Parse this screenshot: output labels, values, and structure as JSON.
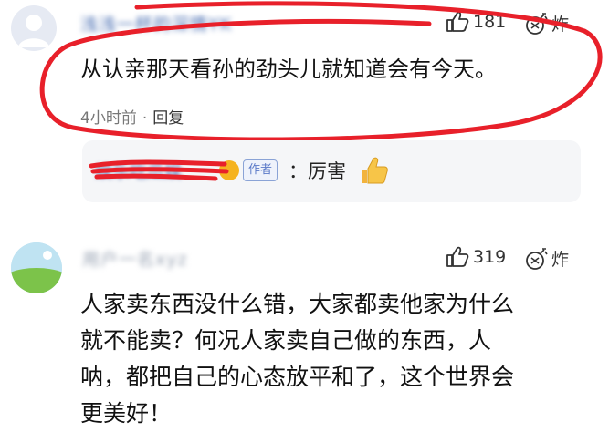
{
  "comments": [
    {
      "username": "浅浅一杯的深情YK",
      "likes": "181",
      "react_label": "炸",
      "text_lines": [
        "从认亲那天看孙的劲头儿就知道会有今天。"
      ],
      "time": "4小时前",
      "separator": "·",
      "reply_label": "回复",
      "reply": {
        "username": "娱乐吃瓜娱",
        "badge": "作者",
        "colon": "：",
        "text": "厉害"
      }
    },
    {
      "username": "用户一名xyz",
      "likes": "319",
      "react_label": "炸",
      "text_lines": [
        "人家卖东西没什么错，大家都卖他家为什么",
        "就不能卖？何况人家卖自己做的东西，人",
        "呐，都把自己的心态放平和了，这个世界会",
        "更美好！"
      ]
    }
  ],
  "colors": {
    "link_blue": "#4a6fb3",
    "annotation_red": "#e8202a",
    "reply_bg": "#f5f6f8"
  },
  "icons": [
    "thumbs-up-icon",
    "bomb-icon",
    "verified-icon",
    "thumbs-up-emoji"
  ]
}
